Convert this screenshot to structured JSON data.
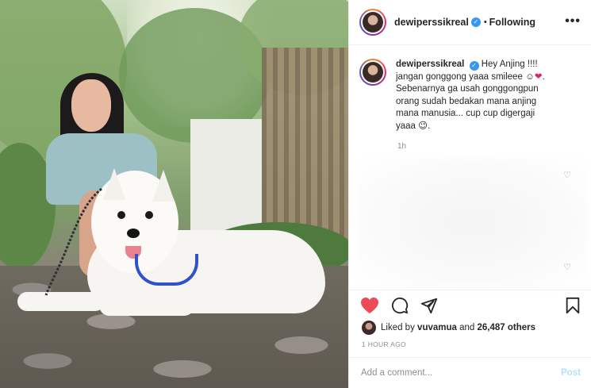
{
  "post": {
    "username": "dewiperssikreal",
    "verified_mark": "✓",
    "separator": "•",
    "follow_status": "Following",
    "more_icon": "more-horizontal-icon",
    "caption": {
      "line1": "Hey Anjing !!!!",
      "line2": "jangan gonggong yaaa smileee",
      "line2_emoji_smile": "☺",
      "line2_emoji_heart": "❤",
      "line2_end": ".",
      "line3": "Sebenarnya ga usah gonggongpun",
      "line4": "orang sudah bedakan mana anjing",
      "line5": "mana manusia... cup cup digergaji",
      "line6": "yaaa",
      "line6_emoji": "😉",
      "line6_end": "."
    },
    "caption_time": "1h",
    "likes": {
      "prefix": "Liked by",
      "user": "vuvamua",
      "joiner": "and",
      "count": "26,487 others"
    },
    "time_ago": "1 HOUR AGO",
    "comment_placeholder": "Add a comment...",
    "post_label": "Post"
  },
  "icons": {
    "like": "heart-filled-icon",
    "comment": "comment-icon",
    "share": "send-icon",
    "save": "bookmark-icon",
    "comment_like": "heart-outline-icon"
  },
  "colors": {
    "like_red": "#ed4956",
    "verified_blue": "#3897f0",
    "post_disabled_blue": "#b2dffc",
    "muted_text": "#8e8e8e"
  }
}
